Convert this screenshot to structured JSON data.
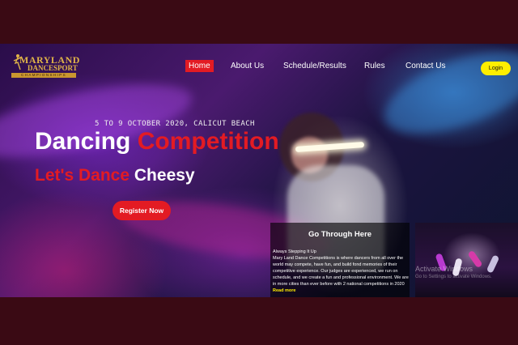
{
  "brand": {
    "name_line1": "MARYLAND",
    "name_line2": "DANCESPORT",
    "name_line3": "CHAMPIONSHIPS"
  },
  "nav": {
    "items": [
      {
        "label": "Home",
        "active": true
      },
      {
        "label": "About Us"
      },
      {
        "label": "Schedule/Results"
      },
      {
        "label": "Rules"
      },
      {
        "label": "Contact Us"
      }
    ],
    "login_label": "Login"
  },
  "hero": {
    "event_info": "5 TO 9 OCTOBER 2020, CALICUT BEACH",
    "title_white": "Dancing",
    "title_red": "Competition",
    "subtitle_red": "Let's Dance",
    "subtitle_white": "Cheesy",
    "register_label": "Register Now"
  },
  "panel": {
    "title": "Go Through Here",
    "subtitle": "Always Stepping It Up",
    "body": "Mary Land Dance Competitions is where dancers from all over the world may compete, have fun, and build fond memories of their competitive experience. Our judges are experienced, we run on schedule, and we create a fun and professional environment. We are in more cities than ever before with 2 national competitions in 2020",
    "read_more": "Read more"
  },
  "overlay": {
    "watermark_line1": "Activate Windows",
    "watermark_line2": "Go to Settings to activate Windows."
  },
  "colors": {
    "accent_red": "#e31b23",
    "login_yellow": "#ffee00",
    "gold": "#e0b448",
    "letterbox": "#3a0a14"
  },
  "icons": [
    "dancer-logo-icon"
  ]
}
